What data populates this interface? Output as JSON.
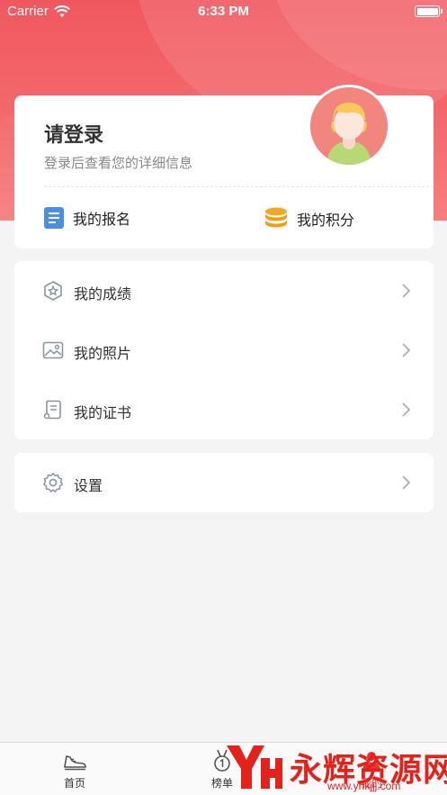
{
  "status_bar": {
    "carrier": "Carrier",
    "time": "6:33 PM"
  },
  "profile": {
    "title": "请登录",
    "subtitle": "登录后查看您的详细信息",
    "enroll_label": "我的报名",
    "points_label": "我的积分"
  },
  "menu": [
    {
      "label": "我的成绩",
      "icon": "badge-star-icon"
    },
    {
      "label": "我的照片",
      "icon": "photo-icon"
    },
    {
      "label": "我的证书",
      "icon": "certificate-icon"
    }
  ],
  "settings": {
    "label": "设置",
    "icon": "gear-icon"
  },
  "tabbar": {
    "home_label": "首页",
    "rank_label": "榜单",
    "mine_label": "我的"
  },
  "watermark": {
    "text": "永辉资源网",
    "url": "www.yhkjjj.com"
  },
  "colors": {
    "accent": "#e8363a",
    "header": "#f0585f",
    "points_icon": "#f5a623",
    "enroll_icon": "#4a90e2"
  }
}
